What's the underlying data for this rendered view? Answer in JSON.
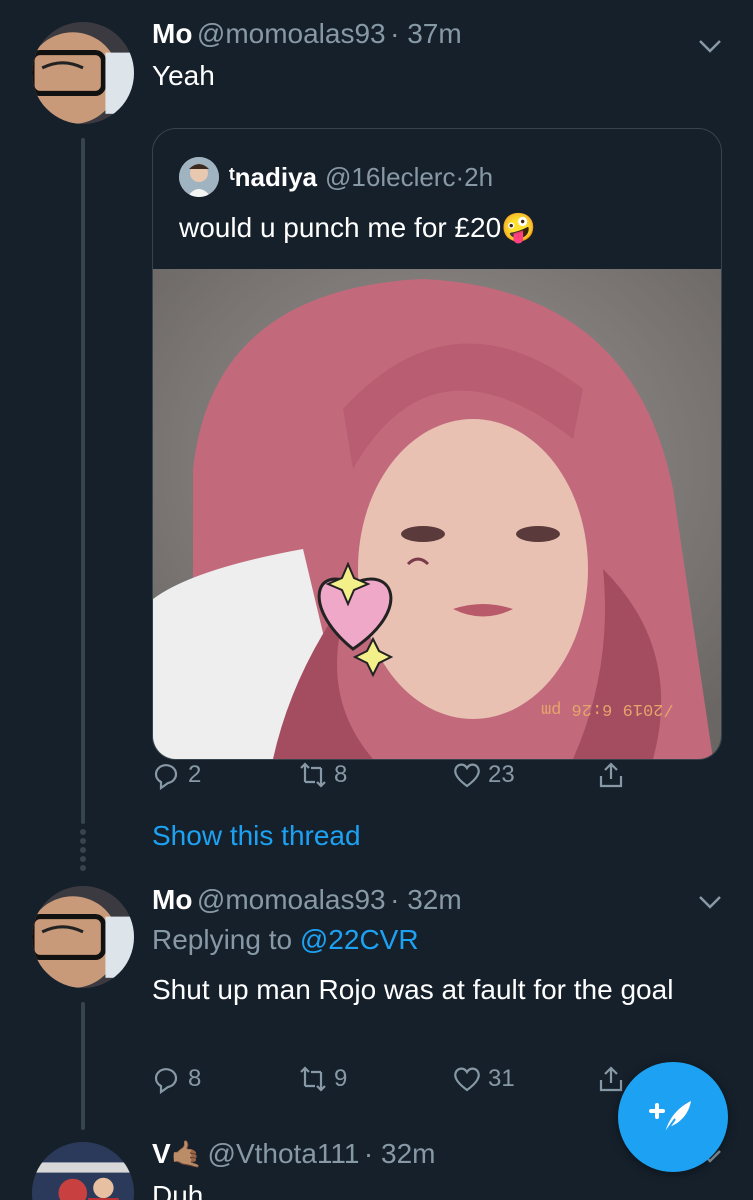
{
  "tweet1": {
    "name": "Mo",
    "handle": "@momoalas93",
    "time": "37m",
    "text": "Yeah",
    "quote": {
      "name": "ᵗnadiya",
      "handle": "@16leclerc",
      "time": "2h",
      "text": "would u punch me for £20",
      "emoji": "🤪",
      "photo_stamp": "/2019 6:26 pm"
    },
    "replies": "2",
    "retweets": "8",
    "likes": "23",
    "show_thread": "Show this thread"
  },
  "tweet2": {
    "name": "Mo",
    "handle": "@momoalas93",
    "time": "32m",
    "replying_prefix": "Replying to",
    "replying_to": "@22CVR",
    "text": "Shut up man Rojo was at fault for the goal",
    "replies": "8",
    "retweets": "9",
    "likes": "31"
  },
  "tweet3": {
    "name": "V",
    "emoji": "🤙🏽",
    "handle": "@Vthota111",
    "time": "32m",
    "text": "Duh"
  },
  "icons": {
    "reply": "reply-icon",
    "retweet": "retweet-icon",
    "like": "heart-icon",
    "share": "share-icon",
    "compose": "compose-tweet-icon",
    "more": "chevron-down-icon"
  },
  "colors": {
    "background": "#15202b",
    "accent": "#1da1f2",
    "secondary_text": "#8899a6",
    "border": "#38444d"
  }
}
